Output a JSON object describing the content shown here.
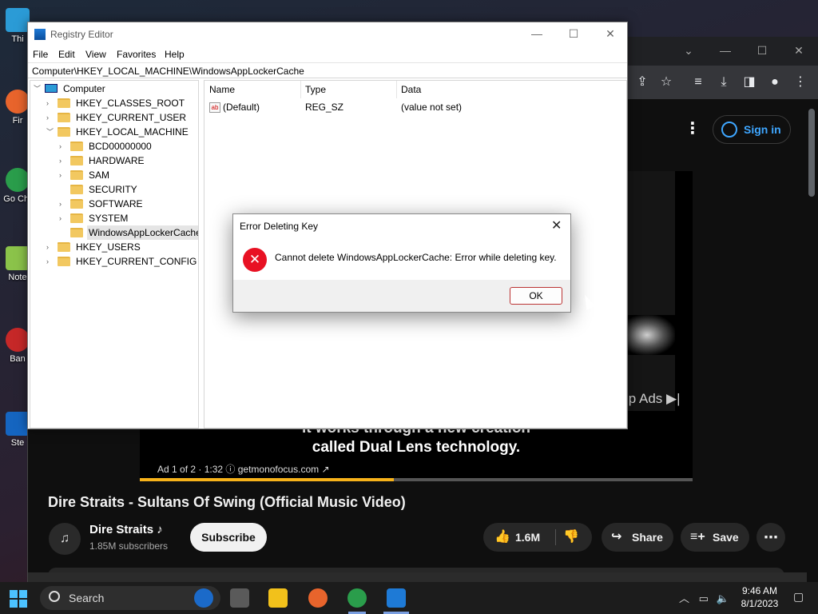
{
  "desktop": {
    "icons": [
      {
        "label": "Thi",
        "color": "#2b9bd6"
      },
      {
        "label": "Fir",
        "color": "#e8642c"
      },
      {
        "label": "Go Chr",
        "color": "#2a9d4b"
      },
      {
        "label": "Note",
        "color": "#8bc34a"
      },
      {
        "label": "Ban",
        "color": "#c62828"
      },
      {
        "label": "Ste",
        "color": "#1565c0"
      }
    ]
  },
  "browser": {
    "sign_in": "Sign in",
    "video": {
      "subtitle_line1": "It works through a new creation",
      "subtitle_line2": "called Dual Lens technology.",
      "ad_info": "Ad 1 of 2 · 1:32  ⓘ  getmonofocus.com ↗",
      "skip": "ip Ads ▶|",
      "progress": 0.46,
      "progress_color": "#f7b21a"
    },
    "title": "Dire Straits - Sultans Of Swing (Official Music Video)",
    "channel_name": "Dire Straits ♪",
    "subscribers": "1.85M subscribers",
    "subscribe": "Subscribe",
    "likes": "1.6M",
    "share": "Share",
    "save": "Save"
  },
  "regedit": {
    "title": "Registry Editor",
    "menu": [
      "File",
      "Edit",
      "View",
      "Favorites",
      "Help"
    ],
    "address": "Computer\\HKEY_LOCAL_MACHINE\\WindowsAppLockerCache",
    "tree": {
      "computer": "Computer",
      "classes_root": "HKEY_CLASSES_ROOT",
      "current_user": "HKEY_CURRENT_USER",
      "local_machine": "HKEY_LOCAL_MACHINE",
      "bcd": "BCD00000000",
      "hardware": "HARDWARE",
      "sam": "SAM",
      "security": "SECURITY",
      "software": "SOFTWARE",
      "system": "SYSTEM",
      "applocker": "WindowsAppLockerCache",
      "users": "HKEY_USERS",
      "current_config": "HKEY_CURRENT_CONFIG"
    },
    "columns": {
      "name": "Name",
      "type": "Type",
      "data": "Data"
    },
    "row": {
      "name": "(Default)",
      "type": "REG_SZ",
      "data": "(value not set)"
    }
  },
  "dialog": {
    "title": "Error Deleting Key",
    "message": "Cannot delete WindowsAppLockerCache:  Error while deleting key.",
    "ok": "OK"
  },
  "taskbar": {
    "search": "Search",
    "time": "9:46 AM",
    "date": "8/1/2023"
  }
}
